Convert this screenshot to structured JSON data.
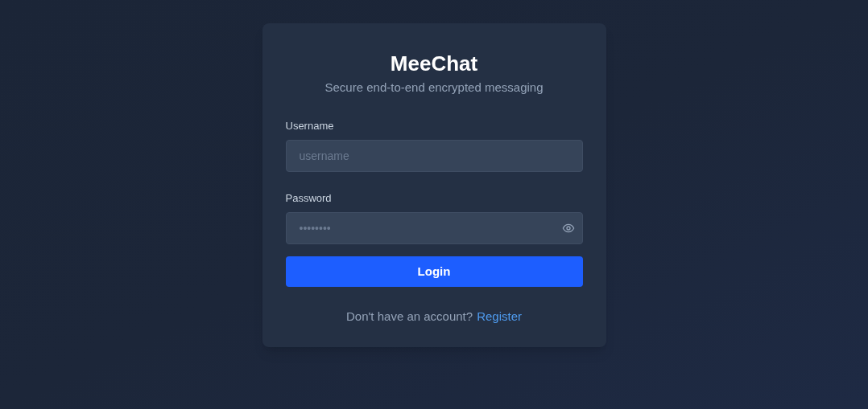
{
  "title": "MeeChat",
  "subtitle": "Secure end-to-end encrypted messaging",
  "fields": [
    {
      "label": "Username",
      "placeholder": "username",
      "kind": "text"
    },
    {
      "label": "Password",
      "placeholder": "••••••••",
      "kind": "password"
    }
  ],
  "login_button": "Login",
  "footer": {
    "text": "Don't have an account?",
    "link": "Register"
  }
}
